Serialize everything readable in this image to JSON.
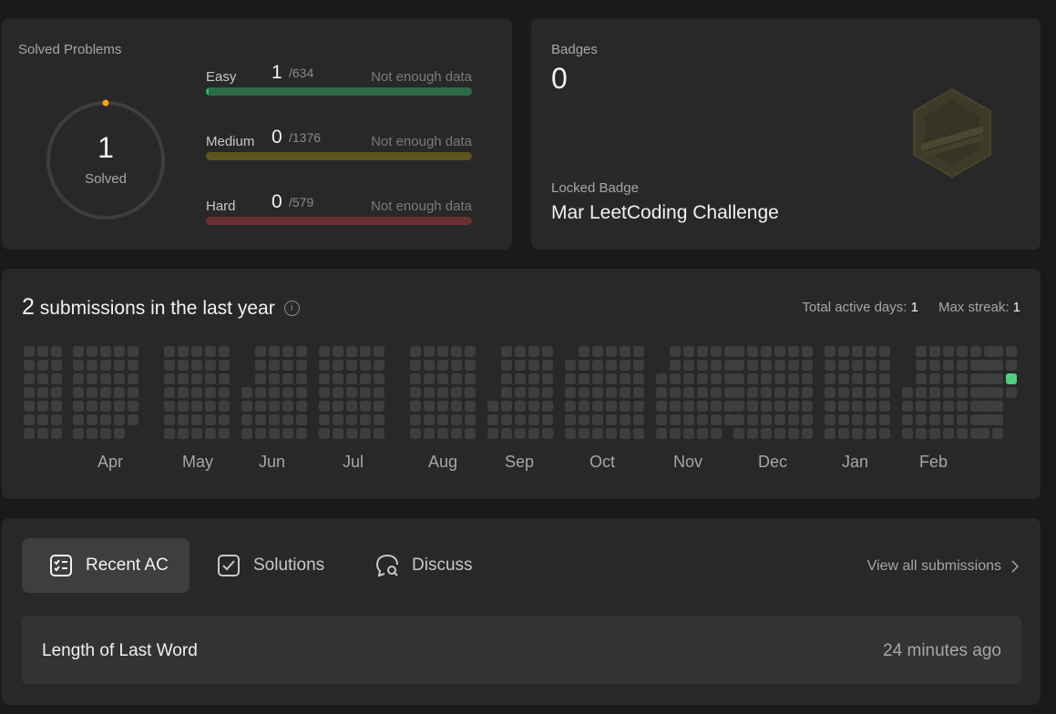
{
  "solved": {
    "title": "Solved Problems",
    "count": "1",
    "count_label": "Solved",
    "difficulties": [
      {
        "name": "Easy",
        "count": "1",
        "total": "/634",
        "note": "Not enough data",
        "progress": 0.0016,
        "track_color": "#2d6b45",
        "fill_color": "#2cbb5d"
      },
      {
        "name": "Medium",
        "count": "0",
        "total": "/1376",
        "note": "Not enough data",
        "progress": 0,
        "track_color": "#5e5420",
        "fill_color": "#ffc01e"
      },
      {
        "name": "Hard",
        "count": "0",
        "total": "/579",
        "note": "Not enough data",
        "progress": 0,
        "track_color": "#6b3131",
        "fill_color": "#ef4743"
      }
    ],
    "ring_color": "#ffa116"
  },
  "badges": {
    "title": "Badges",
    "count": "0",
    "locked_label": "Locked Badge",
    "locked_name": "Mar LeetCoding Challenge"
  },
  "calendar": {
    "submissions": "2",
    "heading_rest": " submissions in the last year",
    "info_icon": "info-icon",
    "total_active_label": "Total active days: ",
    "total_active_value": "1",
    "max_streak_label": "Max streak: ",
    "max_streak_value": "1",
    "months": [
      "Apr",
      "May",
      "Jun",
      "Jul",
      "Aug",
      "Sep",
      "Oct",
      "Nov",
      "Dec",
      "Jan",
      "Feb"
    ],
    "active_color": "#4fce7f"
  },
  "recent": {
    "tabs": [
      {
        "label": "Recent AC",
        "icon": "checklist-icon",
        "active": true
      },
      {
        "label": "Solutions",
        "icon": "checkbox-icon",
        "active": false
      },
      {
        "label": "Discuss",
        "icon": "chat-search-icon",
        "active": false
      }
    ],
    "view_all": "View all submissions",
    "items": [
      {
        "title": "Length of Last Word",
        "time": "24 minutes ago"
      }
    ]
  }
}
